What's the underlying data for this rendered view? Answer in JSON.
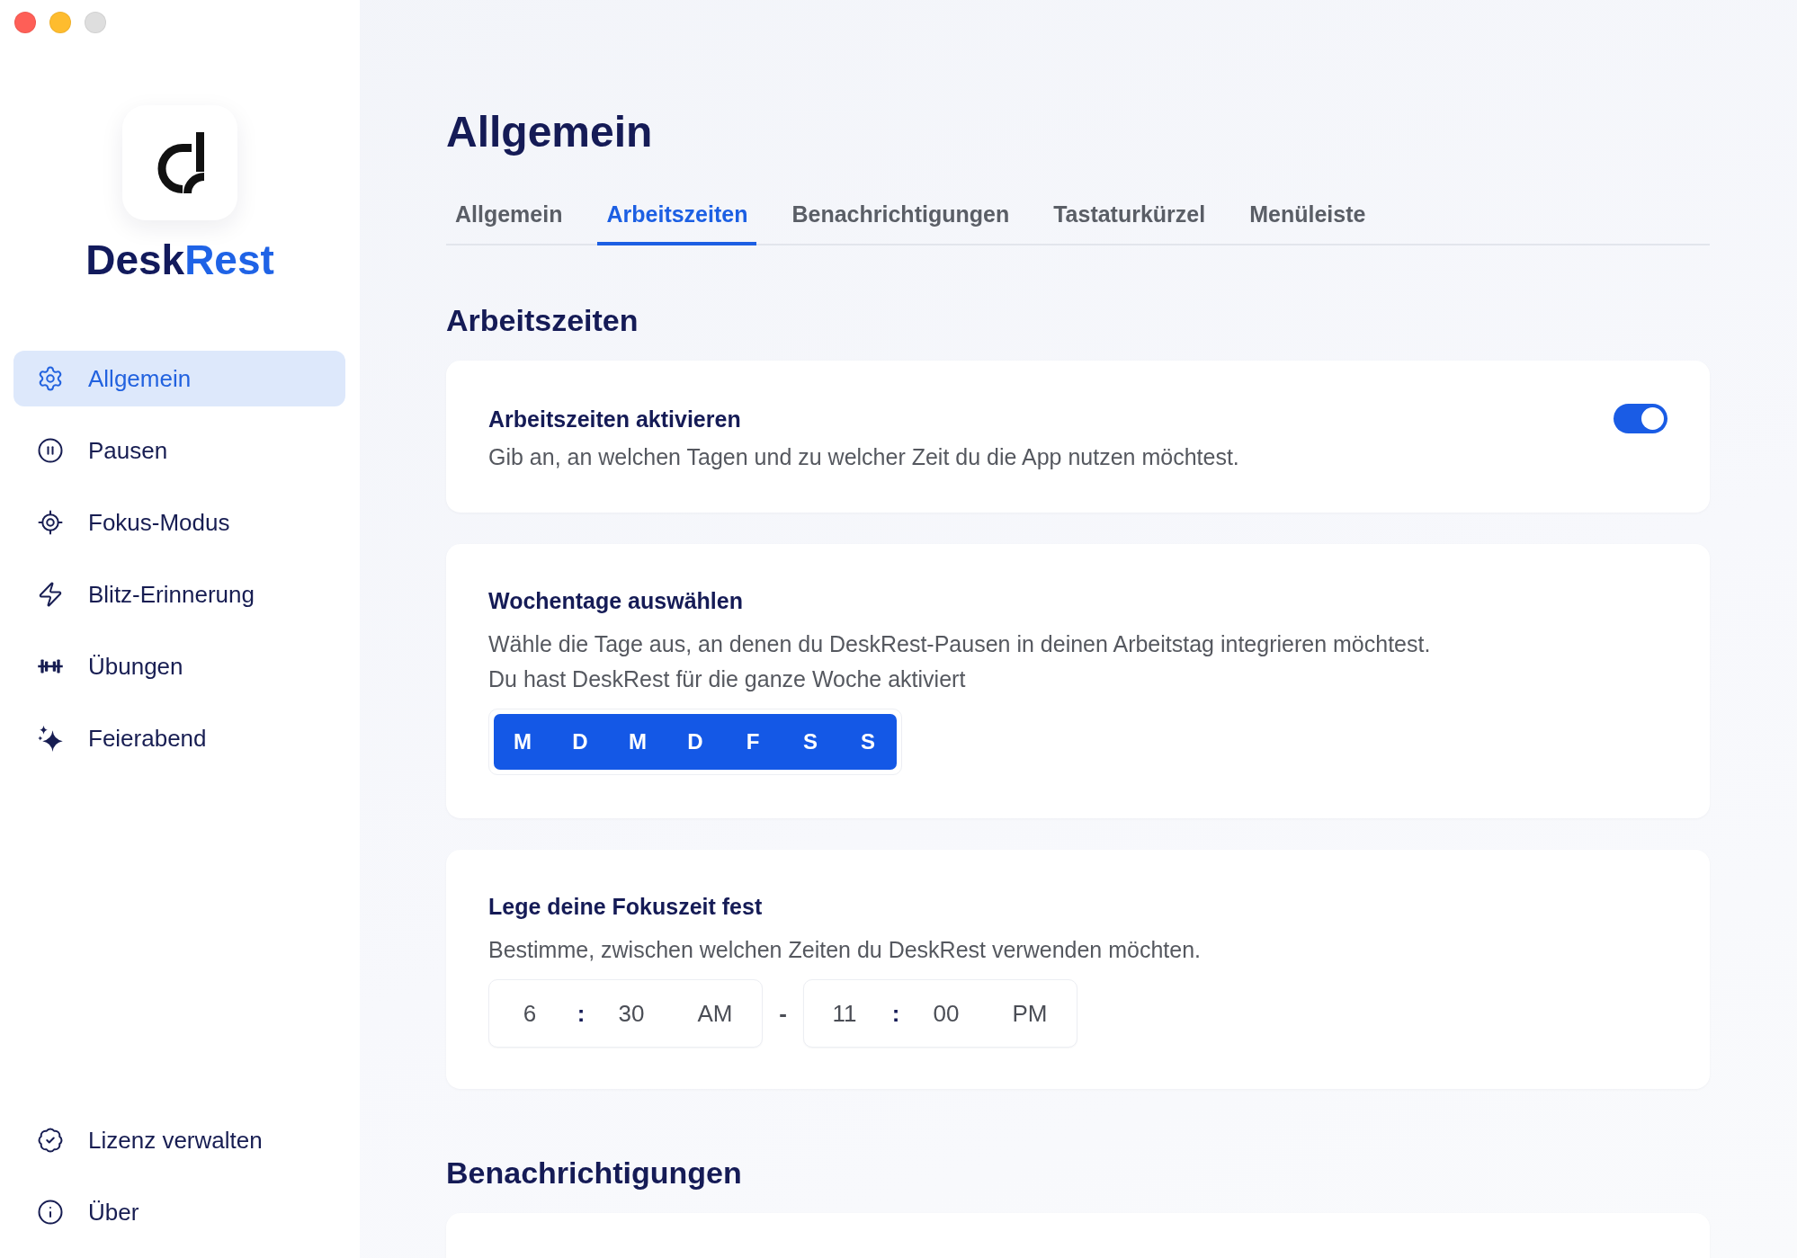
{
  "window": {
    "zoom_enabled": false
  },
  "sidebar": {
    "brand": {
      "name": "Desk",
      "accent": "Rest"
    },
    "items": [
      {
        "label": "Allgemein",
        "selected": true
      },
      {
        "label": "Pausen",
        "selected": false
      },
      {
        "label": "Fokus-Modus",
        "selected": false
      },
      {
        "label": "Blitz-Erinnerung",
        "selected": false
      },
      {
        "label": "Übungen",
        "selected": false
      },
      {
        "label": "Feierabend",
        "selected": false
      }
    ],
    "footer_items": [
      {
        "label": "Lizenz verwalten",
        "selected": false
      },
      {
        "label": "Über",
        "selected": false
      }
    ]
  },
  "page": {
    "title": "Allgemein"
  },
  "tabs": [
    {
      "label": "Allgemein",
      "selected": false
    },
    {
      "label": "Arbeitszeiten",
      "selected": true
    },
    {
      "label": "Benachrichtigungen",
      "selected": false
    },
    {
      "label": "Tastaturkürzel",
      "selected": false
    },
    {
      "label": "Menüleiste",
      "selected": false
    }
  ],
  "sections": [
    {
      "title": "Arbeitszeiten",
      "cards": [
        {
          "kind": "toggle",
          "title": "Arbeitszeiten aktivieren",
          "description": [
            "Gib an, an welchen Tagen und zu welcher Zeit du die App nutzen möchtest."
          ],
          "on": true
        },
        {
          "kind": "weekdays",
          "title": "Wochentage auswählen",
          "description": [
            "Wähle die Tage aus, an denen du DeskRest-Pausen in deinen Arbeitstag integrieren möchtest.",
            "Du hast DeskRest für die ganze Woche aktiviert"
          ],
          "days": [
            {
              "label": "M",
              "selected": true
            },
            {
              "label": "D",
              "selected": true
            },
            {
              "label": "M",
              "selected": true
            },
            {
              "label": "D",
              "selected": true
            },
            {
              "label": "F",
              "selected": true
            },
            {
              "label": "S",
              "selected": true
            },
            {
              "label": "S",
              "selected": true
            }
          ]
        },
        {
          "kind": "time_range",
          "title": "Lege deine Fokuszeit fest",
          "description": [
            "Bestimme, zwischen welchen Zeiten du DeskRest verwenden möchten."
          ],
          "start": {
            "hour": "6",
            "separator": ":",
            "minute": "30",
            "period": "AM"
          },
          "range_separator": "-",
          "end": {
            "hour": "11",
            "separator": ":",
            "minute": "00",
            "period": "PM"
          }
        }
      ]
    },
    {
      "title": "Benachrichtigungen",
      "cards": [
        {
          "kind": "empty"
        }
      ]
    }
  ]
}
